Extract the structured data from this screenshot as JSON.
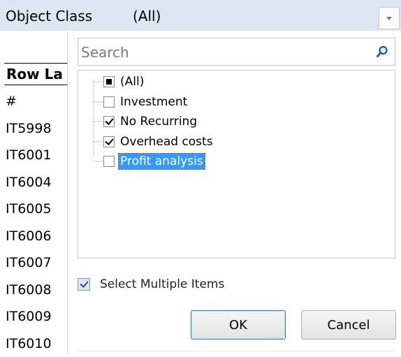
{
  "filter": {
    "label": "Object Class",
    "value": "(All)"
  },
  "rows": {
    "header": "Row La",
    "items": [
      "#",
      "IT5998",
      "IT6001",
      "IT6004",
      "IT6005",
      "IT6006",
      "IT6007",
      "IT6008",
      "IT6009",
      "IT6010"
    ]
  },
  "popup": {
    "search_placeholder": "Search",
    "items": [
      {
        "label": "(All)",
        "state": "mixed"
      },
      {
        "label": "Investment",
        "state": "unchecked"
      },
      {
        "label": "No Recurring",
        "state": "checked"
      },
      {
        "label": "Overhead costs",
        "state": "checked"
      },
      {
        "label": "Profit analysis",
        "state": "unchecked",
        "selected": true
      }
    ],
    "multi_select_label": "Select Multiple Items",
    "multi_select_checked": true,
    "ok_label": "OK",
    "cancel_label": "Cancel"
  },
  "colors": {
    "header_bg": "#dde7f4",
    "selection": "#3399ff"
  },
  "icons": {
    "search": "search-icon",
    "dropdown": "chevron-down-icon"
  }
}
